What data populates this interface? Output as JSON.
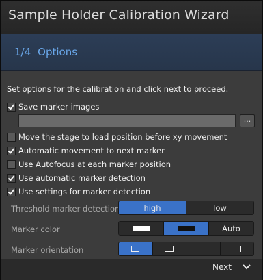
{
  "window": {
    "title": "Sample Holder Calibration Wizard"
  },
  "step": {
    "number": "1/4",
    "name": "Options"
  },
  "description": "Set options for the calibration and click next to proceed.",
  "options": {
    "save_marker_images": {
      "label": "Save marker images",
      "checked": true
    },
    "path_field": {
      "value": ""
    },
    "browse_label": "...",
    "move_stage": {
      "label": "Move the stage to load position before xy movement",
      "checked": false
    },
    "auto_move": {
      "label": "Automatic movement to next marker",
      "checked": true
    },
    "use_autofocus": {
      "label": "Use Autofocus at each marker position",
      "checked": false
    },
    "auto_detection": {
      "label": "Use automatic marker detection",
      "checked": true
    },
    "use_settings": {
      "label": "Use settings for marker detection",
      "checked": true
    }
  },
  "threshold": {
    "label": "Threshold marker detection",
    "options": [
      "high",
      "low"
    ],
    "selected": "high"
  },
  "marker_color": {
    "label": "Marker color",
    "options": [
      "white",
      "black",
      "Auto"
    ],
    "selected": "black",
    "auto_label": "Auto"
  },
  "marker_orientation": {
    "label": "Marker orientation",
    "options": [
      "bottom-left-corner-icon",
      "bottom-right-corner-icon",
      "top-left-corner-icon",
      "top-right-corner-icon"
    ],
    "selected": "bottom-left-corner-icon"
  },
  "footer": {
    "next_label": "Next"
  },
  "colors": {
    "accent": "#3a72c8",
    "step_text": "#6aa8ea"
  }
}
